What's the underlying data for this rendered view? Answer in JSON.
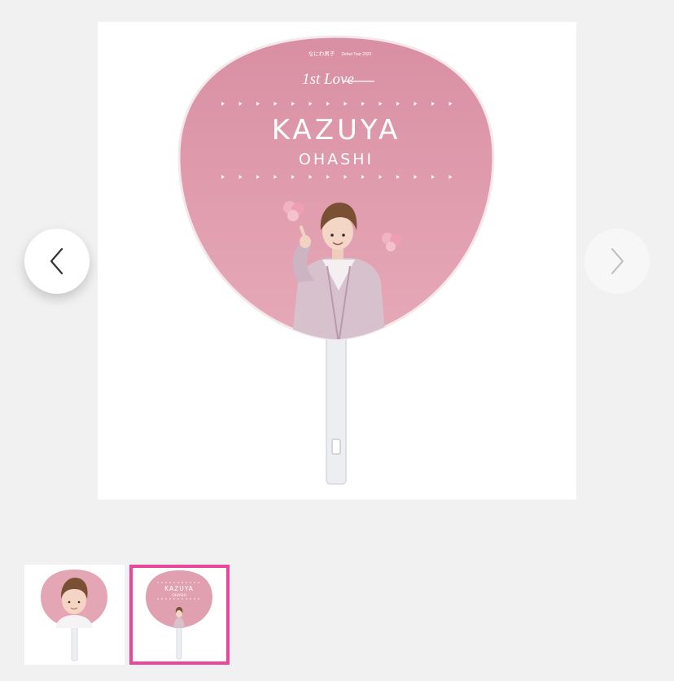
{
  "product_image": {
    "fan_text": {
      "group": "なにわ男子",
      "tour": "Debut Tour 2022",
      "script": "1st Love",
      "first_name": "KAZUYA",
      "last_name": "OHASHI"
    },
    "colors": {
      "fan_pink": "#dd9aac",
      "fan_pink_light": "#e6a7b6",
      "handle": "#eceef2",
      "jacket": "#d8c2cf",
      "hair": "#7a5035"
    }
  },
  "navigation": {
    "prev_icon": "chevron-left-icon",
    "next_icon": "chevron-right-icon"
  },
  "thumbnails": [
    {
      "name": "photo-fan-front",
      "selected": false
    },
    {
      "name": "name-fan-front",
      "selected": true,
      "first_name": "KAZUYA",
      "last_name": "OHASHI",
      "accent": "#e8479a"
    }
  ]
}
